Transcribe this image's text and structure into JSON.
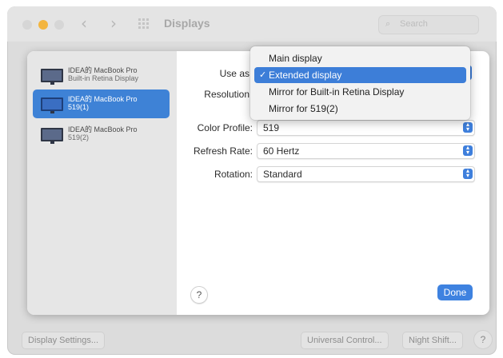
{
  "window": {
    "title": "Displays",
    "search_placeholder": "Search",
    "icons": {
      "back": "chevron-left-icon",
      "forward": "chevron-right-icon",
      "grid": "grid-icon",
      "search": "search-icon"
    }
  },
  "sidebar": {
    "displays": [
      {
        "line1": "IDEA的 MacBook Pro",
        "line2": "Built-in Retina Display",
        "selected": false
      },
      {
        "line1": "IDEA的 MacBook Pro",
        "line2": "519(1)",
        "selected": true
      },
      {
        "line1": "IDEA的 MacBook Pro",
        "line2": "519(2)",
        "selected": false
      }
    ]
  },
  "settings": {
    "use_as_label": "Use as",
    "resolution_label": "Resolution",
    "color_profile_label": "Color Profile:",
    "color_profile_value": "519",
    "refresh_rate_label": "Refresh Rate:",
    "refresh_rate_value": "60 Hertz",
    "rotation_label": "Rotation:",
    "rotation_value": "Standard"
  },
  "use_as_menu": {
    "items": [
      {
        "label": "Main display",
        "checked": false
      },
      {
        "label": "Extended display",
        "checked": true
      },
      {
        "label": "Mirror for Built-in Retina Display",
        "checked": false
      },
      {
        "label": "Mirror for 519(2)",
        "checked": false
      }
    ],
    "checkmark": "✓"
  },
  "sheet_buttons": {
    "help": "?",
    "done": "Done"
  },
  "bottom_bar": {
    "display_settings": "Display Settings...",
    "universal_control": "Universal Control...",
    "night_shift": "Night Shift...",
    "help": "?"
  },
  "colors": {
    "accent": "#3e82d6",
    "traffic_minimize": "#f3b53f"
  }
}
